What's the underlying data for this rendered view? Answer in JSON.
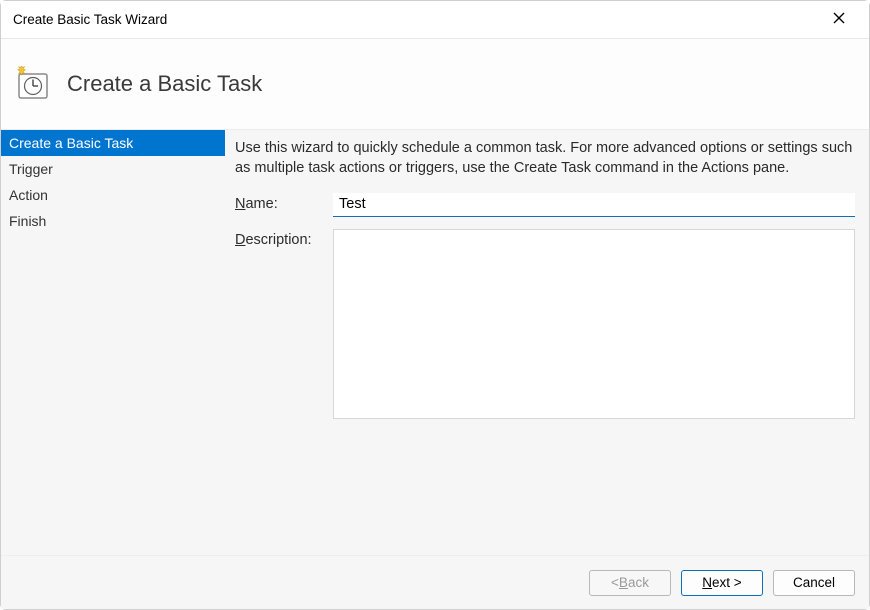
{
  "window": {
    "title": "Create Basic Task Wizard"
  },
  "header": {
    "title": "Create a Basic Task"
  },
  "sidebar": {
    "steps": [
      {
        "label": "Create a Basic Task",
        "selected": true
      },
      {
        "label": "Trigger",
        "selected": false
      },
      {
        "label": "Action",
        "selected": false
      },
      {
        "label": "Finish",
        "selected": false
      }
    ]
  },
  "content": {
    "intro": "Use this wizard to quickly schedule a common task.  For more advanced options or settings such as multiple task actions or triggers, use the Create Task command in the Actions pane.",
    "name_label_rest": "ame:",
    "name_value": "Test",
    "description_label_rest": "escription:",
    "description_value": ""
  },
  "footer": {
    "back_rest": "ack",
    "next_rest": "ext >",
    "cancel": "Cancel"
  }
}
